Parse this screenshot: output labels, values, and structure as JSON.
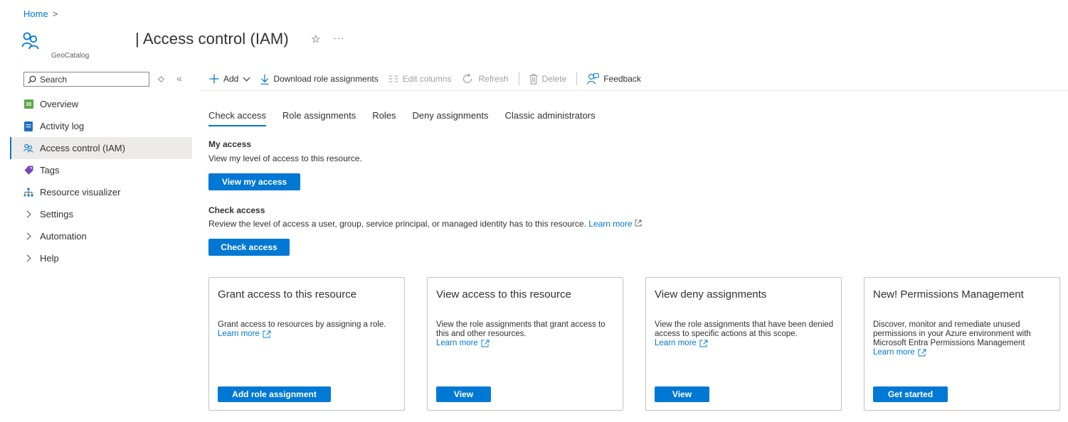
{
  "breadcrumb": {
    "home": "Home",
    "separator": ">"
  },
  "header": {
    "title": "| Access control (IAM)",
    "resource_type": "GeoCatalog",
    "star_glyph": "☆",
    "more_glyph": "···"
  },
  "sidebar": {
    "search_placeholder": "Search",
    "items": [
      {
        "label": "Overview",
        "icon": "overview-icon",
        "active": false
      },
      {
        "label": "Activity log",
        "icon": "activity-log-icon",
        "active": false
      },
      {
        "label": "Access control (IAM)",
        "icon": "iam-icon",
        "active": true
      },
      {
        "label": "Tags",
        "icon": "tag-icon",
        "active": false
      },
      {
        "label": "Resource visualizer",
        "icon": "visualizer-icon",
        "active": false
      },
      {
        "label": "Settings",
        "icon": "chevron-right-icon",
        "active": false
      },
      {
        "label": "Automation",
        "icon": "chevron-right-icon",
        "active": false
      },
      {
        "label": "Help",
        "icon": "chevron-right-icon",
        "active": false
      }
    ]
  },
  "toolbar": {
    "add": "Add",
    "download": "Download role assignments",
    "edit_columns": "Edit columns",
    "refresh": "Refresh",
    "delete": "Delete",
    "feedback": "Feedback"
  },
  "tabs": [
    "Check access",
    "Role assignments",
    "Roles",
    "Deny assignments",
    "Classic administrators"
  ],
  "my_access": {
    "title": "My access",
    "desc": "View my level of access to this resource.",
    "button": "View my access"
  },
  "check_access": {
    "title": "Check access",
    "desc": "Review the level of access a user, group, service principal, or managed identity has to this resource.",
    "learn_more": "Learn more",
    "button": "Check access"
  },
  "cards": [
    {
      "title": "Grant access to this resource",
      "body": "Grant access to resources by assigning a role.",
      "learn_more": "Learn more",
      "button": "Add role assignment"
    },
    {
      "title": "View access to this resource",
      "body": "View the role assignments that grant access to this and other resources.",
      "learn_more": "Learn more",
      "button": "View"
    },
    {
      "title": "View deny assignments",
      "body": "View the role assignments that have been denied access to specific actions at this scope.",
      "learn_more": "Learn more",
      "button": "View"
    },
    {
      "title": "New! Permissions Management",
      "body": "Discover, monitor and remediate unused permissions in your Azure environment with Microsoft Entra Permissions Management",
      "learn_more": "Learn more",
      "button": "Get started"
    }
  ],
  "colors": {
    "accent": "#0078d4",
    "text": "#323130",
    "border": "#c8c6c4"
  }
}
